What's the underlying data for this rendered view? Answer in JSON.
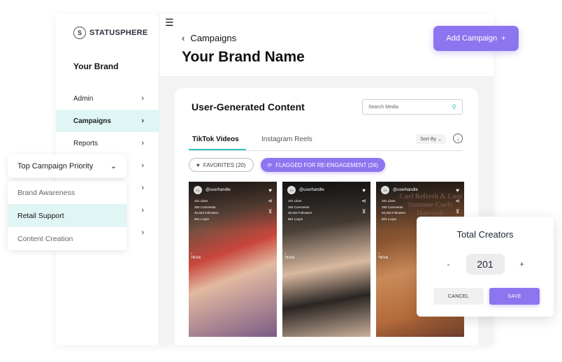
{
  "logo": {
    "mark": "S",
    "text": "STATUSPHERE"
  },
  "sidebar": {
    "brand": "Your Brand",
    "items": [
      {
        "label": "Admin",
        "active": false
      },
      {
        "label": "Campaigns",
        "active": true
      },
      {
        "label": "Reports",
        "active": false
      },
      {
        "label": "",
        "active": false
      },
      {
        "label": "",
        "active": false
      },
      {
        "label": "",
        "active": false
      },
      {
        "label": "",
        "active": false
      }
    ]
  },
  "header": {
    "menu_icon": "☰",
    "back_icon": "‹",
    "breadcrumb": "Campaigns",
    "title": "Your Brand Name"
  },
  "add_campaign": {
    "label": "Add Campaign",
    "icon": "+"
  },
  "ugc": {
    "title": "User-Generated Content",
    "search_placeholder": "Search Media",
    "search_icon": "⚲",
    "tabs": [
      {
        "label": "TikTok Videos",
        "active": true
      },
      {
        "label": "Instagram Reels",
        "active": false
      }
    ],
    "sort_label": "Sort By",
    "sort_chevron": "⌄",
    "download_icon": "↓",
    "filters": {
      "favorites": {
        "icon": "♥",
        "label": "FAVORITES (20)"
      },
      "flagged": {
        "icon": "⟳",
        "label": "FLAGGED FOR RE-ENGAGEMENT (24)"
      }
    },
    "videos": [
      {
        "avatar": "SS",
        "handle": "@userhandle",
        "likes": "101 Likes",
        "comments": "250 Comments",
        "followers": "40,323 Followers",
        "loops": "601 Loops",
        "tiktok": "TikTok",
        "caption": ""
      },
      {
        "avatar": "SS",
        "handle": "@userhandle",
        "likes": "101 Likes",
        "comments": "250 Comments",
        "followers": "40,323 Followers",
        "loops": "601 Loops",
        "tiktok": "TikTok",
        "caption": ""
      },
      {
        "avatar": "SS",
        "handle": "@userhandle",
        "likes": "101 Likes",
        "comments": "250 Comments",
        "followers": "40,323 Followers",
        "loops": "601 Loops",
        "tiktok": "TikTok",
        "caption": "Curl Refresh & Cute Summer Curly Hairstyle"
      }
    ]
  },
  "priority_dropdown": {
    "label": "Top Campaign Priority",
    "chevron": "⌄",
    "options": [
      {
        "label": "Brand Awareness",
        "selected": false
      },
      {
        "label": "Retail Support",
        "selected": true
      },
      {
        "label": "Content Creation",
        "selected": false
      }
    ]
  },
  "total_creators": {
    "title": "Total Creators",
    "minus": "-",
    "value": "201",
    "plus": "+",
    "cancel": "CANCEL",
    "save": "SAVE"
  },
  "colors": {
    "accent_purple": "#8d75f0",
    "accent_teal": "#2fc6c6",
    "selected_bg": "#e0f6f5"
  }
}
